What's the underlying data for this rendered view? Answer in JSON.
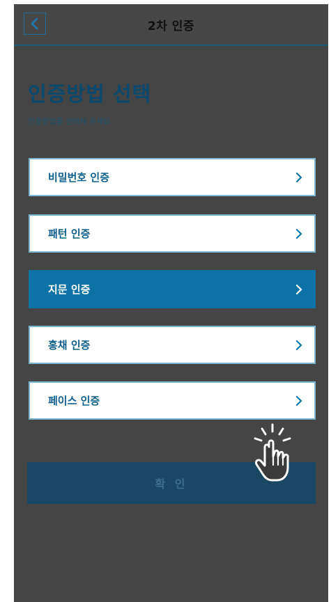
{
  "header": {
    "title": "2차 인증"
  },
  "page": {
    "title": "인증방법 선택",
    "subtitle": "인증방법을 선택해 주세요"
  },
  "methods": [
    {
      "label": "비밀번호 인증",
      "selected": false
    },
    {
      "label": "패턴 인증",
      "selected": false
    },
    {
      "label": "지문 인증",
      "selected": true
    },
    {
      "label": "홍채 인증",
      "selected": false
    },
    {
      "label": "페이스 인증",
      "selected": false
    }
  ],
  "confirm": {
    "label": "확 인"
  },
  "colors": {
    "overlay_bg": "#454545",
    "accent": "#0d73a7",
    "item_text": "#0d5f8e",
    "confirm_bg": "#1a4864"
  },
  "icons": {
    "back": "chevron-left-icon",
    "item_arrow": "chevron-right-icon",
    "pointer": "tap-hand-icon"
  }
}
